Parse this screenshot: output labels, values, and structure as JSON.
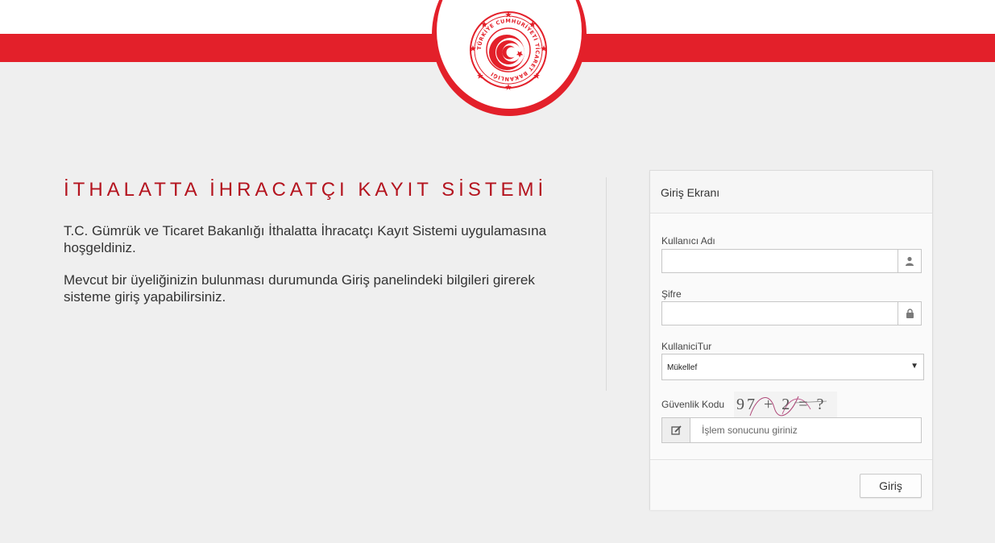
{
  "header": {
    "logo_icon": "ministry-seal-icon",
    "logo_ring_text": "TÜRKİYE CUMHURİYETİ TİCARET BAKANLIĞI",
    "band_color": "#e3202a"
  },
  "intro": {
    "title": "İTHALATTA İHRACATÇI KAYIT SİSTEMİ",
    "paragraph1": "T.C. Gümrük ve Ticaret Bakanlığı İthalatta İhracatçı Kayıt Sistemi uygulamasına hoşgeldiniz.",
    "paragraph2": "Mevcut bir üyeliğinizin bulunması durumunda Giriş panelindeki bilgileri girerek sisteme giriş yapabilirsiniz."
  },
  "login": {
    "panel_title": "Giriş Ekranı",
    "username_label": "Kullanıcı Adı",
    "username_value": "",
    "username_icon": "user-icon",
    "password_label": "Şifre",
    "password_value": "",
    "password_icon": "lock-icon",
    "usertype_label": "KullaniciTur",
    "usertype_value": "Mükellef",
    "captcha_label": "Güvenlik Kodu",
    "captcha_text": "97 + 2 = ?",
    "captcha_placeholder": "İşlem sonucunu giriniz",
    "captcha_icon": "edit-icon",
    "submit_label": "Giriş"
  }
}
